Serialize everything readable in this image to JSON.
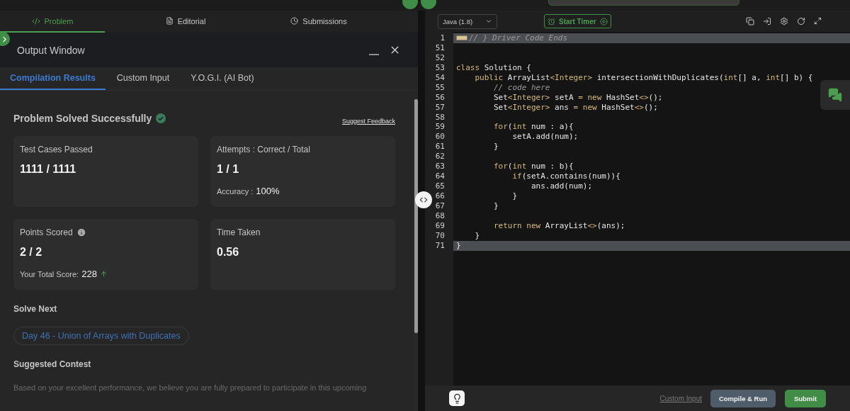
{
  "left_tabs": [
    {
      "label": "Problem",
      "selected": true
    },
    {
      "label": "Editorial",
      "selected": false
    },
    {
      "label": "Submissions",
      "selected": false
    }
  ],
  "output_window": {
    "title": "Output Window",
    "tabs": [
      {
        "label": "Compilation Results",
        "selected": true
      },
      {
        "label": "Custom Input",
        "selected": false
      },
      {
        "label": "Y.O.G.I. (AI Bot)",
        "selected": false
      }
    ],
    "status": "Problem Solved Successfully",
    "feedback_link": "Suggest Feedback",
    "cards": [
      {
        "label": "Test Cases Passed",
        "value": "1111 / 1111"
      },
      {
        "label": "Attempts : Correct / Total",
        "value": "1 / 1",
        "sub_label": "Accuracy :",
        "sub_value": "100%"
      },
      {
        "label": "Points Scored",
        "value": "2 / 2",
        "info": true,
        "sub_label": "Your Total Score:",
        "sub_value": "228",
        "trend_up": true
      },
      {
        "label": "Time Taken",
        "value": "0.56"
      }
    ],
    "solve_next_heading": "Solve Next",
    "solve_next": "Day 46 - Union of Arrays with Duplicates",
    "contest_heading": "Suggested Contest",
    "contest_text": "Based on your excellent performance, we believe you are fully prepared to participate in this upcoming"
  },
  "editor": {
    "language": "Java (1.8)",
    "timer_button": "Start Timer",
    "lines": [
      {
        "number": "1",
        "highlighted": true,
        "folded": true,
        "tokens": [
          {
            "kind": "comment",
            "text": "// } Driver Code Ends"
          }
        ]
      },
      {
        "number": "51",
        "highlighted": false
      },
      {
        "number": "52",
        "highlighted": false
      },
      {
        "number": "53",
        "highlighted": false,
        "tokens": [
          {
            "kind": "kw",
            "text": "class"
          },
          {
            "kind": "plain",
            "text": " Solution {"
          }
        ]
      },
      {
        "number": "54",
        "highlighted": false,
        "tokens": [
          {
            "kind": "kw",
            "text": "    public"
          },
          {
            "kind": "plain",
            "text": " ArrayList"
          },
          {
            "kind": "kw",
            "text": "<Integer>"
          },
          {
            "kind": "plain",
            "text": " intersectionWithDuplicates("
          },
          {
            "kind": "kw",
            "text": "int"
          },
          {
            "kind": "plain",
            "text": "[] a, "
          },
          {
            "kind": "kw",
            "text": "int"
          },
          {
            "kind": "plain",
            "text": "[] b) {"
          }
        ]
      },
      {
        "number": "55",
        "highlighted": false,
        "tokens": [
          {
            "kind": "comment",
            "text": "        // code here"
          }
        ]
      },
      {
        "number": "56",
        "highlighted": false,
        "tokens": [
          {
            "kind": "plain",
            "text": "        Set"
          },
          {
            "kind": "kw",
            "text": "<Integer>"
          },
          {
            "kind": "plain",
            "text": " setA "
          },
          {
            "kind": "kw",
            "text": "= new"
          },
          {
            "kind": "plain",
            "text": " HashSet"
          },
          {
            "kind": "kw",
            "text": "<>"
          },
          {
            "kind": "plain",
            "text": "();"
          }
        ]
      },
      {
        "number": "57",
        "highlighted": false,
        "tokens": [
          {
            "kind": "plain",
            "text": "        Set"
          },
          {
            "kind": "kw",
            "text": "<Integer>"
          },
          {
            "kind": "plain",
            "text": " ans "
          },
          {
            "kind": "kw",
            "text": "= new"
          },
          {
            "kind": "plain",
            "text": " HashSet"
          },
          {
            "kind": "kw",
            "text": "<>"
          },
          {
            "kind": "plain",
            "text": "();"
          }
        ]
      },
      {
        "number": "58",
        "highlighted": false
      },
      {
        "number": "59",
        "highlighted": false,
        "tokens": [
          {
            "kind": "kw",
            "text": "        for"
          },
          {
            "kind": "plain",
            "text": "("
          },
          {
            "kind": "kw",
            "text": "int"
          },
          {
            "kind": "plain",
            "text": " num : a){"
          }
        ]
      },
      {
        "number": "60",
        "highlighted": false,
        "tokens": [
          {
            "kind": "plain",
            "text": "            setA.add(num);"
          }
        ]
      },
      {
        "number": "61",
        "highlighted": false,
        "tokens": [
          {
            "kind": "plain",
            "text": "        }"
          }
        ]
      },
      {
        "number": "62",
        "highlighted": false
      },
      {
        "number": "63",
        "highlighted": false,
        "tokens": [
          {
            "kind": "kw",
            "text": "        for"
          },
          {
            "kind": "plain",
            "text": "("
          },
          {
            "kind": "kw",
            "text": "int"
          },
          {
            "kind": "plain",
            "text": " num : b){"
          }
        ]
      },
      {
        "number": "64",
        "highlighted": false,
        "tokens": [
          {
            "kind": "kw",
            "text": "            if"
          },
          {
            "kind": "plain",
            "text": "(setA.contains(num)){"
          }
        ]
      },
      {
        "number": "65",
        "highlighted": false,
        "tokens": [
          {
            "kind": "plain",
            "text": "                ans.add(num);"
          }
        ]
      },
      {
        "number": "66",
        "highlighted": false,
        "tokens": [
          {
            "kind": "plain",
            "text": "            }"
          }
        ]
      },
      {
        "number": "67",
        "highlighted": false,
        "tokens": [
          {
            "kind": "plain",
            "text": "        }"
          }
        ]
      },
      {
        "number": "68",
        "highlighted": false
      },
      {
        "number": "69",
        "highlighted": false,
        "tokens": [
          {
            "kind": "kw",
            "text": "        return new"
          },
          {
            "kind": "plain",
            "text": " ArrayList"
          },
          {
            "kind": "kw",
            "text": "<>"
          },
          {
            "kind": "plain",
            "text": "(ans);"
          }
        ]
      },
      {
        "number": "70",
        "highlighted": false,
        "tokens": [
          {
            "kind": "plain",
            "text": "    }"
          }
        ]
      },
      {
        "number": "71",
        "highlighted": true,
        "tokens": [
          {
            "kind": "plain",
            "text": "}"
          }
        ]
      }
    ],
    "custom_input_link": "Custom Input",
    "compile_button": "Compile & Run",
    "submit_button": "Submit"
  }
}
